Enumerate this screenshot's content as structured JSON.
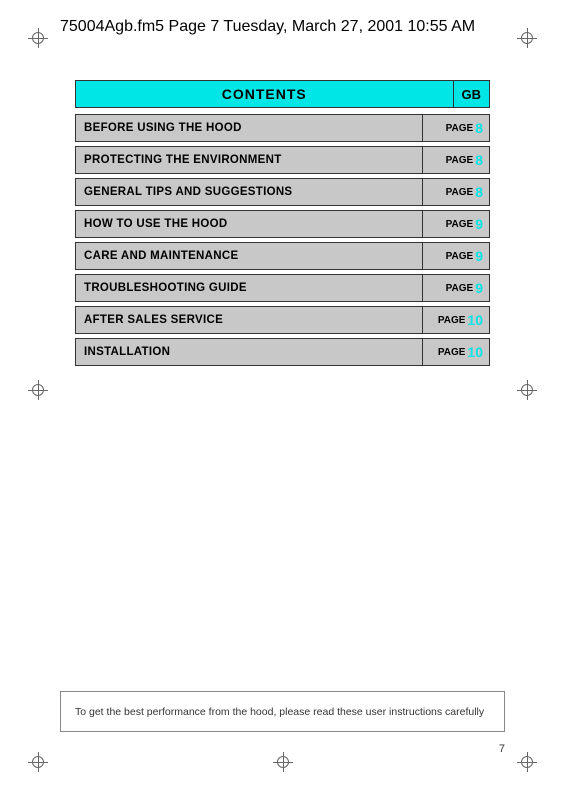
{
  "header": {
    "filename": "75004Agb.fm5  Page 7  Tuesday, March 27, 2001  10:55 AM"
  },
  "contents": {
    "title": "CONTENTS",
    "gb_label": "GB"
  },
  "toc": {
    "items": [
      {
        "label": "BEFORE USING THE HOOD",
        "page_prefix": "PAGE",
        "page_num": "8"
      },
      {
        "label": "PROTECTING THE ENVIRONMENT",
        "page_prefix": "PAGE",
        "page_num": "8"
      },
      {
        "label": "GENERAL TIPS AND SUGGESTIONS",
        "page_prefix": "PAGE",
        "page_num": "8"
      },
      {
        "label": "HOW TO USE THE HOOD",
        "page_prefix": "PAGE",
        "page_num": "9"
      },
      {
        "label": "CARE AND MAINTENANCE",
        "page_prefix": "PAGE",
        "page_num": "9"
      },
      {
        "label": "TROUBLESHOOTING GUIDE",
        "page_prefix": "PAGE",
        "page_num": "9"
      },
      {
        "label": "AFTER SALES SERVICE",
        "page_prefix": "PAGE",
        "page_num": "10"
      },
      {
        "label": "INSTALLATION",
        "page_prefix": "PAGE",
        "page_num": "10"
      }
    ]
  },
  "footer": {
    "note": "To get the best performance from the hood, please read these user instructions carefully",
    "page_number": "7"
  }
}
